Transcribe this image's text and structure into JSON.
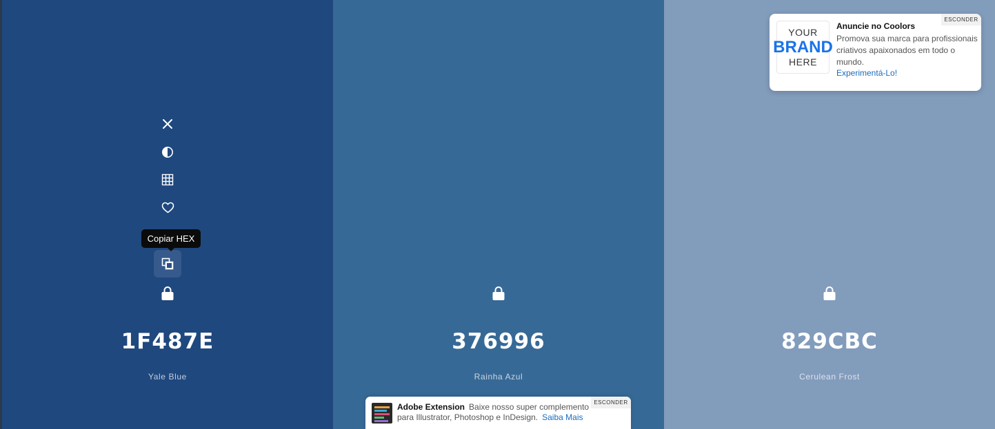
{
  "palette": {
    "colors": [
      {
        "hex": "1F487E",
        "name": "Yale Blue",
        "bg": "#1F487E"
      },
      {
        "hex": "376996",
        "name": "Rainha Azul",
        "bg": "#376996"
      },
      {
        "hex": "829CBC",
        "name": "Cerulean Frost",
        "bg": "#829CBC"
      }
    ],
    "tools": [
      "close-icon",
      "contrast-icon",
      "shades-grid-icon",
      "heart-icon",
      "copy-icon",
      "lock-icon"
    ],
    "tooltip": "Copiar HEX"
  },
  "ad_card": {
    "logo_line1": "YOUR",
    "logo_line2": "BRAND",
    "logo_line3": "HERE",
    "title": "Anuncie no Coolors",
    "text": "Promova sua marca para profissionais criativos apaixonados em todo o mundo.",
    "link": "Experimentá-Lo!",
    "hide": "ESCONDER"
  },
  "ad_banner": {
    "title": "Adobe Extension",
    "text1": "Baixe nosso super complemento",
    "text2": "para Illustrator, Photoshop e InDesign.",
    "link": "Saiba Mais",
    "hide": "ESCONDER"
  }
}
